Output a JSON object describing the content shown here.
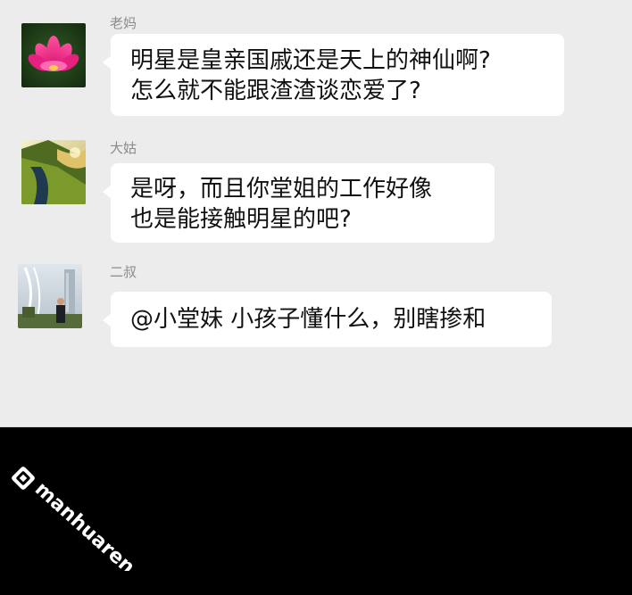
{
  "messages": [
    {
      "sender": "老妈",
      "avatar": "lotus-flower-avatar",
      "lines": [
        "明星是皇亲国戚还是天上的神仙啊?",
        "怎么就不能跟渣渣谈恋爱了?"
      ]
    },
    {
      "sender": "大姑",
      "avatar": "landscape-river-avatar",
      "lines": [
        "是呀，而且你堂姐的工作好像",
        "也是能接触明星的吧?"
      ]
    },
    {
      "sender": "二叔",
      "avatar": "man-portrait-avatar",
      "lines": [
        "@小堂妹 小孩子懂什么，别瞎掺和"
      ]
    }
  ],
  "watermark": {
    "text": "manhuaren.com",
    "icon": "manhuaren-logo-icon"
  },
  "colors": {
    "chat_background": "#ececec",
    "bubble": "#ffffff",
    "sender_name": "#8c8c8c",
    "page_background": "#000000"
  }
}
